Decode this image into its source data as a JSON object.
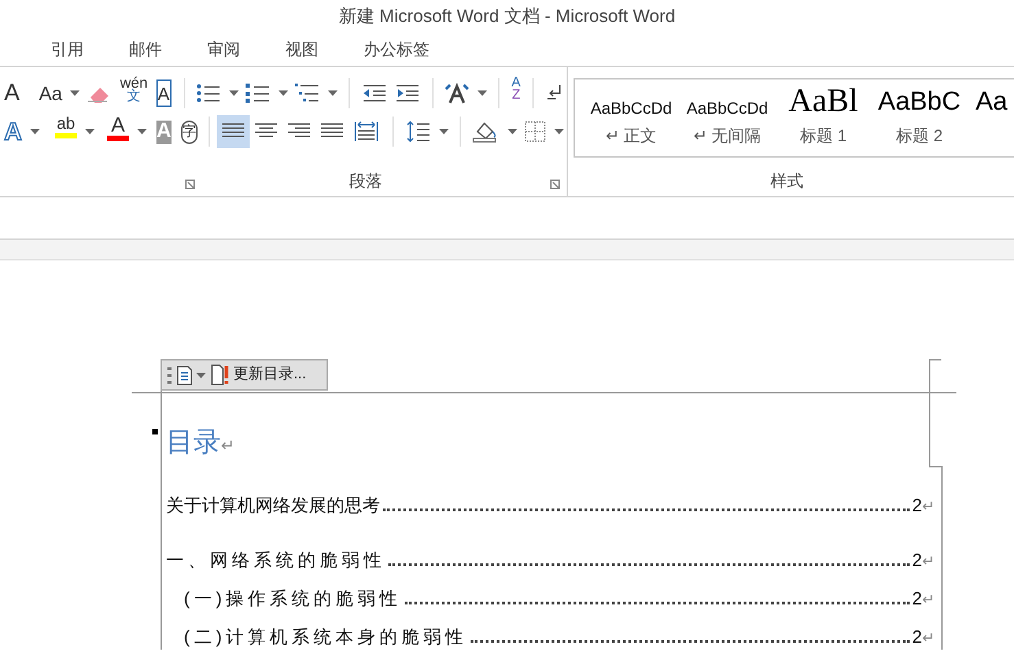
{
  "window": {
    "title": "新建 Microsoft Word 文档 - Microsoft Word"
  },
  "tabs": [
    {
      "label": "引用",
      "selected": false
    },
    {
      "label": "邮件",
      "selected": false
    },
    {
      "label": "审阅",
      "selected": false
    },
    {
      "label": "视图",
      "selected": false
    },
    {
      "label": "办公标签",
      "selected": false
    }
  ],
  "ribbon": {
    "row_1": [
      {
        "kind": "grow",
        "glyph": "A",
        "dropdown": false
      },
      {
        "kind": "case",
        "glyph": "Aa",
        "dropdown": true
      },
      {
        "kind": "eraser",
        "dropdown": false
      },
      {
        "kind": "pinyin",
        "glyph": "wén",
        "glyph_2": "文",
        "dropdown": false
      },
      {
        "kind": "boxed",
        "glyph": "A",
        "dropdown": false
      },
      {
        "kind": "sep"
      },
      {
        "kind": "bullets",
        "dropdown": true
      },
      {
        "kind": "numbering",
        "dropdown": true
      },
      {
        "kind": "multilevel",
        "dropdown": true
      },
      {
        "kind": "sep"
      },
      {
        "kind": "outdent",
        "dropdown": false
      },
      {
        "kind": "indent",
        "dropdown": false
      },
      {
        "kind": "sep"
      },
      {
        "kind": "layout",
        "dropdown": true
      },
      {
        "kind": "sep"
      },
      {
        "kind": "sort",
        "glyph": "A",
        "glyph_2": "Z",
        "dropdown": false
      },
      {
        "kind": "sep"
      },
      {
        "kind": "marks",
        "dropdown": false
      }
    ],
    "row_2": [
      {
        "kind": "effect",
        "glyph": "A",
        "dropdown": true
      },
      {
        "kind": "highlight",
        "glyph": "ab",
        "dropdown": true
      },
      {
        "kind": "fontcolor",
        "glyph": "A",
        "dropdown": true
      },
      {
        "kind": "shade",
        "glyph": "A",
        "dropdown": false
      },
      {
        "kind": "enclose",
        "glyph": "字",
        "dropdown": false
      },
      {
        "kind": "sep"
      },
      {
        "kind": "align_left",
        "selected": true,
        "dropdown": false
      },
      {
        "kind": "align_center",
        "selected": false,
        "dropdown": false
      },
      {
        "kind": "align_right",
        "selected": false,
        "dropdown": false
      },
      {
        "kind": "justify",
        "selected": false,
        "dropdown": false
      },
      {
        "kind": "distribute",
        "selected": false,
        "dropdown": false
      },
      {
        "kind": "sep"
      },
      {
        "kind": "spacing",
        "dropdown": true
      },
      {
        "kind": "sep"
      },
      {
        "kind": "fill",
        "dropdown": true
      },
      {
        "kind": "borders",
        "dropdown": true
      }
    ],
    "paragraph_group": "段落",
    "styles": [
      {
        "kind": "normal",
        "sample": "AaBbCcDd",
        "mark": "↵",
        "label": "正文"
      },
      {
        "kind": "normal",
        "sample": "AaBbCcDd",
        "mark": "↵",
        "label": "无间隔"
      },
      {
        "kind": "heading1",
        "sample": "AaBl",
        "label": "标题 1"
      },
      {
        "kind": "heading2",
        "sample": "AaBbC",
        "label": "标题 2"
      },
      {
        "kind": "heading2",
        "sample": "Aa"
      }
    ],
    "styles_group": "样式"
  },
  "document": {
    "toc_toolbar": {
      "button": "更新目录..."
    },
    "toc_title": "目录",
    "toc_title_mark": "↵",
    "entries": [
      {
        "kind": "plain",
        "text": "关于计算机网络发展的思考",
        "page": "2",
        "mark": "↵"
      },
      {
        "kind": "spaced",
        "text": "一、网络系统的脆弱性",
        "page": "2",
        "mark": "↵",
        "children": [
          {
            "kind": "spaced",
            "text": "(一)操作系统的脆弱性",
            "page": "2",
            "mark": "↵"
          },
          {
            "kind": "spaced",
            "text": "(二)计算机系统本身的脆弱性",
            "page": "2",
            "mark": "↵"
          }
        ]
      }
    ]
  }
}
